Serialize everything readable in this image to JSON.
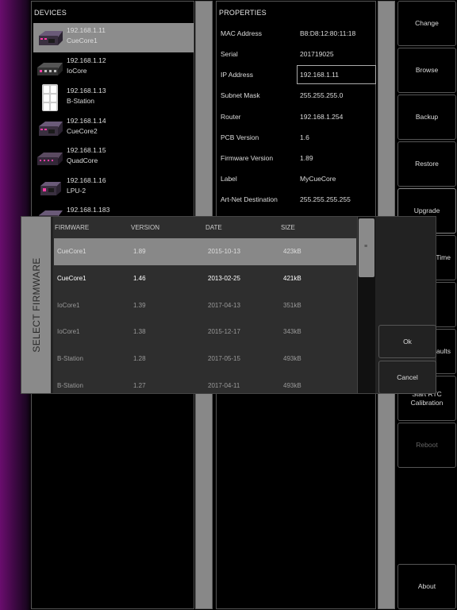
{
  "devices": {
    "header": "DEVICES",
    "items": [
      {
        "ip": "192.168.1.11",
        "name": "CueCore1",
        "icon": "cuecore-device-icon",
        "selected": true
      },
      {
        "ip": "192.168.1.12",
        "name": "IoCore",
        "icon": "iocore-device-icon",
        "selected": false
      },
      {
        "ip": "192.168.1.13",
        "name": "B-Station",
        "icon": "bstation-device-icon",
        "selected": false
      },
      {
        "ip": "192.168.1.14",
        "name": "CueCore2",
        "icon": "cuecore-device-icon",
        "selected": false
      },
      {
        "ip": "192.168.1.15",
        "name": "QuadCore",
        "icon": "quadcore-device-icon",
        "selected": false
      },
      {
        "ip": "192.168.1.16",
        "name": "LPU-2",
        "icon": "lpu-device-icon",
        "selected": false
      },
      {
        "ip": "192.168.1.183",
        "name": "",
        "icon": "device-icon",
        "selected": false
      }
    ]
  },
  "properties": {
    "header": "PROPERTIES",
    "rows": [
      {
        "label": "MAC Address",
        "value": "B8:D8:12:80:11:18"
      },
      {
        "label": "Serial",
        "value": "201719025"
      },
      {
        "label": "IP Address",
        "value": "192.168.1.11",
        "editable": true
      },
      {
        "label": "Subnet Mask",
        "value": "255.255.255.0"
      },
      {
        "label": "Router",
        "value": "192.168.1.254"
      },
      {
        "label": "PCB Version",
        "value": "1.6"
      },
      {
        "label": "Firmware Version",
        "value": "1.89"
      },
      {
        "label": "Label",
        "value": "MyCueCore"
      },
      {
        "label": "Art-Net Destination",
        "value": "255.255.255.255"
      }
    ]
  },
  "buttons": {
    "change": "Change",
    "browse": "Browse",
    "backup": "Backup",
    "restore": "Restore",
    "upgrade": "Upgrade",
    "time": "Time",
    "defaults": "faults",
    "rtc": "Start RTC\nCalibration",
    "reboot": "Reboot",
    "about": "About"
  },
  "modal": {
    "title": "SELECT FIRMWARE",
    "columns": [
      "FIRMWARE",
      "VERSION",
      "DATE",
      "SIZE"
    ],
    "rows": [
      {
        "firmware": "CueCore1",
        "version": "1.89",
        "date": "2015-10-13",
        "size": "423kB",
        "selected": true,
        "style": "dim"
      },
      {
        "firmware": "CueCore1",
        "version": "1.46",
        "date": "2013-02-25",
        "size": "421kB",
        "selected": false,
        "style": "bright"
      },
      {
        "firmware": "IoCore1",
        "version": "1.39",
        "date": "2017-04-13",
        "size": "351kB",
        "selected": false,
        "style": "dim"
      },
      {
        "firmware": "IoCore1",
        "version": "1.38",
        "date": "2015-12-17",
        "size": "343kB",
        "selected": false,
        "style": "dim"
      },
      {
        "firmware": "B-Station",
        "version": "1.28",
        "date": "2017-05-15",
        "size": "493kB",
        "selected": false,
        "style": "dim"
      },
      {
        "firmware": "B-Station",
        "version": "1.27",
        "date": "2017-04-11",
        "size": "493kB",
        "selected": false,
        "style": "dim"
      }
    ],
    "scroll_glyph": "≡",
    "ok": "Ok",
    "cancel": "Cancel"
  },
  "colors": {
    "selection": "#888888",
    "panel_border": "#555555",
    "accent_purple": "#6a0d6e",
    "dim_text": "#9a9a9a",
    "bright_text": "#ffffff"
  }
}
